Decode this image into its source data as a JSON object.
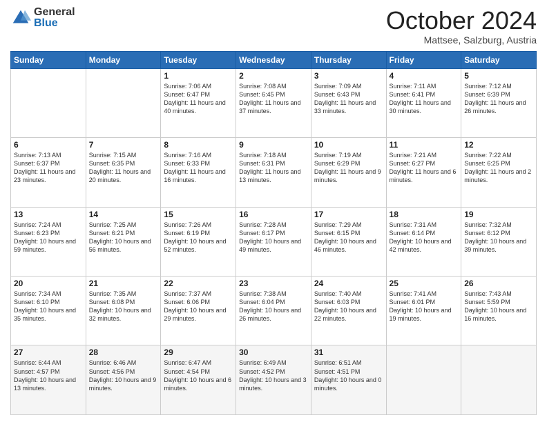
{
  "logo": {
    "general": "General",
    "blue": "Blue"
  },
  "header": {
    "month": "October 2024",
    "location": "Mattsee, Salzburg, Austria"
  },
  "weekdays": [
    "Sunday",
    "Monday",
    "Tuesday",
    "Wednesday",
    "Thursday",
    "Friday",
    "Saturday"
  ],
  "weeks": [
    [
      {
        "day": "",
        "detail": ""
      },
      {
        "day": "",
        "detail": ""
      },
      {
        "day": "1",
        "detail": "Sunrise: 7:06 AM\nSunset: 6:47 PM\nDaylight: 11 hours and 40 minutes."
      },
      {
        "day": "2",
        "detail": "Sunrise: 7:08 AM\nSunset: 6:45 PM\nDaylight: 11 hours and 37 minutes."
      },
      {
        "day": "3",
        "detail": "Sunrise: 7:09 AM\nSunset: 6:43 PM\nDaylight: 11 hours and 33 minutes."
      },
      {
        "day": "4",
        "detail": "Sunrise: 7:11 AM\nSunset: 6:41 PM\nDaylight: 11 hours and 30 minutes."
      },
      {
        "day": "5",
        "detail": "Sunrise: 7:12 AM\nSunset: 6:39 PM\nDaylight: 11 hours and 26 minutes."
      }
    ],
    [
      {
        "day": "6",
        "detail": "Sunrise: 7:13 AM\nSunset: 6:37 PM\nDaylight: 11 hours and 23 minutes."
      },
      {
        "day": "7",
        "detail": "Sunrise: 7:15 AM\nSunset: 6:35 PM\nDaylight: 11 hours and 20 minutes."
      },
      {
        "day": "8",
        "detail": "Sunrise: 7:16 AM\nSunset: 6:33 PM\nDaylight: 11 hours and 16 minutes."
      },
      {
        "day": "9",
        "detail": "Sunrise: 7:18 AM\nSunset: 6:31 PM\nDaylight: 11 hours and 13 minutes."
      },
      {
        "day": "10",
        "detail": "Sunrise: 7:19 AM\nSunset: 6:29 PM\nDaylight: 11 hours and 9 minutes."
      },
      {
        "day": "11",
        "detail": "Sunrise: 7:21 AM\nSunset: 6:27 PM\nDaylight: 11 hours and 6 minutes."
      },
      {
        "day": "12",
        "detail": "Sunrise: 7:22 AM\nSunset: 6:25 PM\nDaylight: 11 hours and 2 minutes."
      }
    ],
    [
      {
        "day": "13",
        "detail": "Sunrise: 7:24 AM\nSunset: 6:23 PM\nDaylight: 10 hours and 59 minutes."
      },
      {
        "day": "14",
        "detail": "Sunrise: 7:25 AM\nSunset: 6:21 PM\nDaylight: 10 hours and 56 minutes."
      },
      {
        "day": "15",
        "detail": "Sunrise: 7:26 AM\nSunset: 6:19 PM\nDaylight: 10 hours and 52 minutes."
      },
      {
        "day": "16",
        "detail": "Sunrise: 7:28 AM\nSunset: 6:17 PM\nDaylight: 10 hours and 49 minutes."
      },
      {
        "day": "17",
        "detail": "Sunrise: 7:29 AM\nSunset: 6:15 PM\nDaylight: 10 hours and 46 minutes."
      },
      {
        "day": "18",
        "detail": "Sunrise: 7:31 AM\nSunset: 6:14 PM\nDaylight: 10 hours and 42 minutes."
      },
      {
        "day": "19",
        "detail": "Sunrise: 7:32 AM\nSunset: 6:12 PM\nDaylight: 10 hours and 39 minutes."
      }
    ],
    [
      {
        "day": "20",
        "detail": "Sunrise: 7:34 AM\nSunset: 6:10 PM\nDaylight: 10 hours and 35 minutes."
      },
      {
        "day": "21",
        "detail": "Sunrise: 7:35 AM\nSunset: 6:08 PM\nDaylight: 10 hours and 32 minutes."
      },
      {
        "day": "22",
        "detail": "Sunrise: 7:37 AM\nSunset: 6:06 PM\nDaylight: 10 hours and 29 minutes."
      },
      {
        "day": "23",
        "detail": "Sunrise: 7:38 AM\nSunset: 6:04 PM\nDaylight: 10 hours and 26 minutes."
      },
      {
        "day": "24",
        "detail": "Sunrise: 7:40 AM\nSunset: 6:03 PM\nDaylight: 10 hours and 22 minutes."
      },
      {
        "day": "25",
        "detail": "Sunrise: 7:41 AM\nSunset: 6:01 PM\nDaylight: 10 hours and 19 minutes."
      },
      {
        "day": "26",
        "detail": "Sunrise: 7:43 AM\nSunset: 5:59 PM\nDaylight: 10 hours and 16 minutes."
      }
    ],
    [
      {
        "day": "27",
        "detail": "Sunrise: 6:44 AM\nSunset: 4:57 PM\nDaylight: 10 hours and 13 minutes."
      },
      {
        "day": "28",
        "detail": "Sunrise: 6:46 AM\nSunset: 4:56 PM\nDaylight: 10 hours and 9 minutes."
      },
      {
        "day": "29",
        "detail": "Sunrise: 6:47 AM\nSunset: 4:54 PM\nDaylight: 10 hours and 6 minutes."
      },
      {
        "day": "30",
        "detail": "Sunrise: 6:49 AM\nSunset: 4:52 PM\nDaylight: 10 hours and 3 minutes."
      },
      {
        "day": "31",
        "detail": "Sunrise: 6:51 AM\nSunset: 4:51 PM\nDaylight: 10 hours and 0 minutes."
      },
      {
        "day": "",
        "detail": ""
      },
      {
        "day": "",
        "detail": ""
      }
    ]
  ]
}
